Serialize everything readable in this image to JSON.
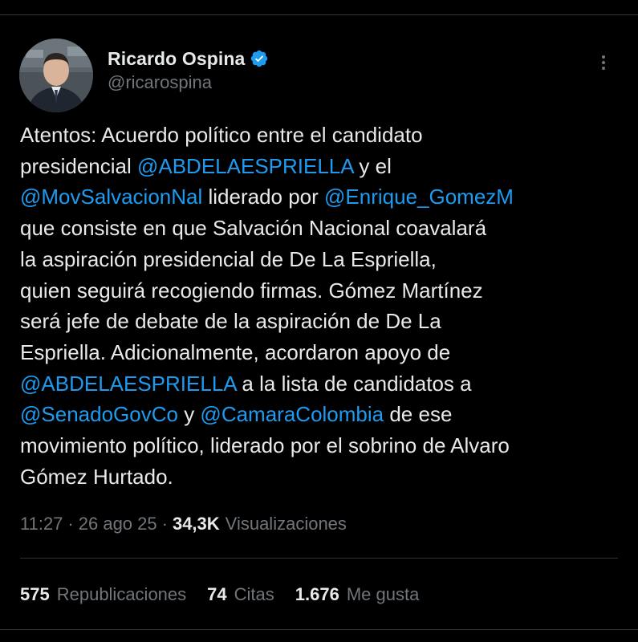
{
  "author": {
    "display_name": "Ricardo Ospina",
    "handle": "@ricarospina",
    "verified": true,
    "verified_icon": "verified-badge-icon"
  },
  "tweet": {
    "lines": [
      [
        {
          "t": "Atentos: Acuerdo político entre el candidato",
          "m": false
        }
      ],
      [
        {
          "t": "presidencial ",
          "m": false
        },
        {
          "t": "@ABDELAESPRIELLA",
          "m": true
        },
        {
          "t": " y el",
          "m": false
        }
      ],
      [
        {
          "t": "@MovSalvacionNal",
          "m": true
        },
        {
          "t": " liderado por ",
          "m": false
        },
        {
          "t": "@Enrique_GomezM",
          "m": true
        }
      ],
      [
        {
          "t": "que consiste en que Salvación Nacional coavalará",
          "m": false
        }
      ],
      [
        {
          "t": "la aspiración presidencial de De La Espriella,",
          "m": false
        }
      ],
      [
        {
          "t": "quien seguirá recogiendo firmas. Gómez Martínez",
          "m": false
        }
      ],
      [
        {
          "t": "será jefe de debate de la aspiración de De La",
          "m": false
        }
      ],
      [
        {
          "t": "Espriella. Adicionalmente, acordaron apoyo de",
          "m": false
        }
      ],
      [
        {
          "t": "@ABDELAESPRIELLA",
          "m": true
        },
        {
          "t": " a la lista de candidatos a",
          "m": false
        }
      ],
      [
        {
          "t": "@SenadoGovCo",
          "m": true
        },
        {
          "t": " y ",
          "m": false
        },
        {
          "t": "@CamaraColombia",
          "m": true
        },
        {
          "t": " de ese",
          "m": false
        }
      ],
      [
        {
          "t": "movimiento político, liderado por el sobrino de Alvaro",
          "m": false
        }
      ],
      [
        {
          "t": "Gómez Hurtado.",
          "m": false
        }
      ]
    ]
  },
  "meta": {
    "time": "11:27",
    "separator": "·",
    "date": "26 ago 25",
    "views_count": "34,3K",
    "views_label": "Visualizaciones"
  },
  "stats": {
    "reposts_count": "575",
    "reposts_label": "Republicaciones",
    "quotes_count": "74",
    "quotes_label": "Citas",
    "likes_count": "1.676",
    "likes_label": "Me gusta"
  },
  "colors": {
    "background": "#000000",
    "text": "#e7e9ea",
    "secondary": "#71767b",
    "link": "#1d9bf0",
    "divider": "#2f3336"
  },
  "icons": {
    "more": "more-options-icon",
    "avatar": "avatar"
  }
}
